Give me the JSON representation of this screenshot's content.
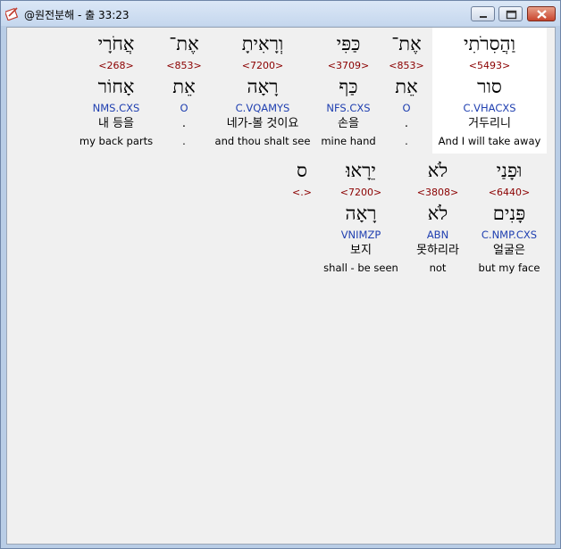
{
  "window": {
    "title": "@원전분해 - 출 33:23"
  },
  "row1": [
    {
      "hebrew": "וַהֲסִרֹתִי",
      "strong": "<5493>",
      "lemma": "סור",
      "morph": "C.VHACXS",
      "korean": "거두리니",
      "english": "And I will take away"
    },
    {
      "hebrew": "אֶת־",
      "strong": "<853>",
      "lemma": "אֵת",
      "morph": "O",
      "korean": ".",
      "english": "."
    },
    {
      "hebrew": "כַּפִּי",
      "strong": "<3709>",
      "lemma": "כַּף",
      "morph": "NFS.CXS",
      "korean": "손을",
      "english": "mine hand"
    },
    {
      "hebrew": "וְרָאִיתָ",
      "strong": "<7200>",
      "lemma": "רָאָה",
      "morph": "C.VQAMYS",
      "korean": "네가-볼 것이요",
      "english": "and thou shalt see"
    },
    {
      "hebrew": "אֶת־",
      "strong": "<853>",
      "lemma": "אֵת",
      "morph": "O",
      "korean": ".",
      "english": "."
    },
    {
      "hebrew": "אֲחֹרָי",
      "strong": "<268>",
      "lemma": "אָחוֹר",
      "morph": "NMS.CXS",
      "korean": "내 등을",
      "english": "my back parts"
    }
  ],
  "row2": [
    {
      "hebrew": "וּפָנַי",
      "strong": "<6440>",
      "lemma": "פָּנִים",
      "morph": "C.NMP.CXS",
      "korean": "얼굴은",
      "english": "but my face"
    },
    {
      "hebrew": "לֹא",
      "strong": "<3808>",
      "lemma": "לֹא",
      "morph": "ABN",
      "korean": "못하리라",
      "english": "not"
    },
    {
      "hebrew": "יֵרָאוּ׃",
      "strong": "<7200>",
      "lemma": "רָאָה",
      "morph": "VNIMZP",
      "korean": "보지",
      "english": "shall - be seen"
    },
    {
      "hebrew": "ס",
      "strong": "<.>",
      "lemma": "",
      "morph": "",
      "korean": "",
      "english": ""
    }
  ]
}
